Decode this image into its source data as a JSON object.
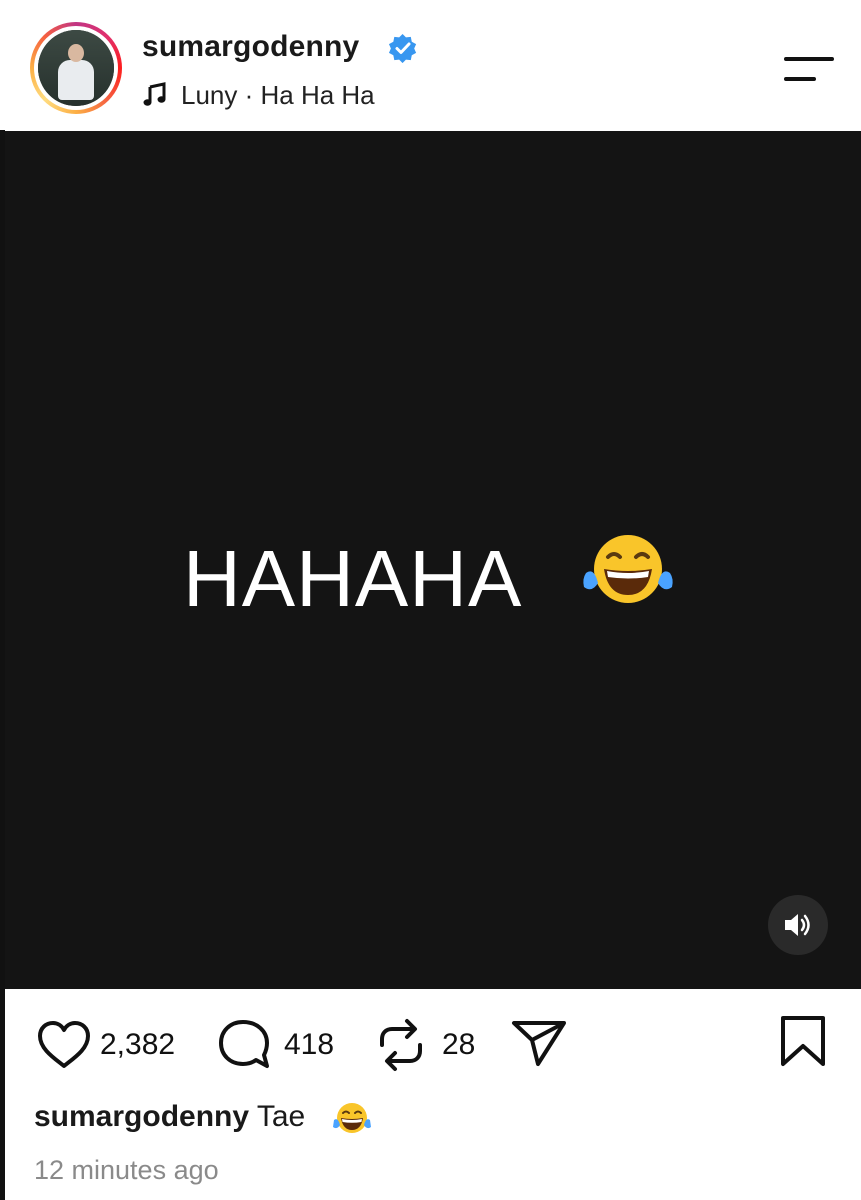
{
  "post": {
    "username": "sumargodenny",
    "music": "Luny · Ha Ha Ha",
    "video_text": "HAHAHA",
    "likes": "2,382",
    "comments": "418",
    "reposts": "28",
    "caption_user": "sumargodenny",
    "caption_text": "Tae",
    "time": "12 minutes ago"
  },
  "colors": {
    "verified": "#3897f0",
    "video_bg": "#141414",
    "secondary_text": "#8a8a8a"
  },
  "icons": [
    "verified-badge-icon",
    "music-note-icon",
    "menu-icon",
    "laughing-emoji-icon",
    "sound-icon",
    "heart-icon",
    "comment-icon",
    "repost-icon",
    "share-icon",
    "bookmark-icon"
  ]
}
